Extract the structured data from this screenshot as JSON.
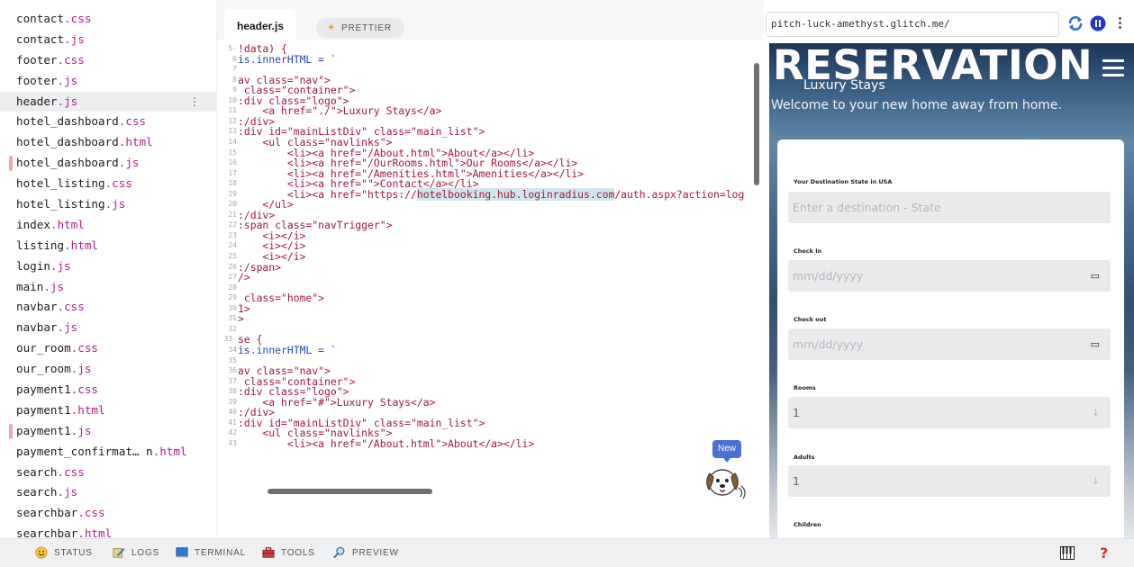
{
  "sidebar": {
    "files": [
      {
        "name": "contact",
        "ext": ".css",
        "marked": false,
        "active": false
      },
      {
        "name": "contact",
        "ext": ".js",
        "marked": false,
        "active": false
      },
      {
        "name": "footer",
        "ext": ".css",
        "marked": false,
        "active": false
      },
      {
        "name": "footer",
        "ext": ".js",
        "marked": false,
        "active": false
      },
      {
        "name": "header",
        "ext": ".js",
        "marked": false,
        "active": true,
        "menu": "⋮"
      },
      {
        "name": "hotel_dashboard",
        "ext": ".css",
        "marked": false,
        "active": false
      },
      {
        "name": "hotel_dashboard",
        "ext": ".html",
        "marked": false,
        "active": false
      },
      {
        "name": "hotel_dashboard",
        "ext": ".js",
        "marked": true,
        "active": false
      },
      {
        "name": "hotel_listing",
        "ext": ".css",
        "marked": false,
        "active": false
      },
      {
        "name": "hotel_listing",
        "ext": ".js",
        "marked": false,
        "active": false
      },
      {
        "name": "index",
        "ext": ".html",
        "marked": false,
        "active": false
      },
      {
        "name": "listing",
        "ext": ".html",
        "marked": false,
        "active": false
      },
      {
        "name": "login",
        "ext": ".js",
        "marked": false,
        "active": false
      },
      {
        "name": "main",
        "ext": ".js",
        "marked": false,
        "active": false
      },
      {
        "name": "navbar",
        "ext": ".css",
        "marked": false,
        "active": false
      },
      {
        "name": "navbar",
        "ext": ".js",
        "marked": false,
        "active": false
      },
      {
        "name": "our_room",
        "ext": ".css",
        "marked": false,
        "active": false
      },
      {
        "name": "our_room",
        "ext": ".js",
        "marked": false,
        "active": false
      },
      {
        "name": "payment1",
        "ext": ".css",
        "marked": false,
        "active": false
      },
      {
        "name": "payment1",
        "ext": ".html",
        "marked": false,
        "active": false
      },
      {
        "name": "payment1",
        "ext": ".js",
        "marked": true,
        "active": false
      },
      {
        "name": "payment_confirmat… n",
        "ext": ".html",
        "marked": false,
        "active": false
      },
      {
        "name": "search",
        "ext": ".css",
        "marked": false,
        "active": false
      },
      {
        "name": "search",
        "ext": ".js",
        "marked": false,
        "active": false
      },
      {
        "name": "searchbar",
        "ext": ".css",
        "marked": false,
        "active": false
      },
      {
        "name": "searchbar",
        "ext": ".html",
        "marked": false,
        "active": false
      }
    ]
  },
  "editor": {
    "tab_label": "header.js",
    "prettier_label": "PRETTIER",
    "new_badge": "New",
    "lines": [
      {
        "n": "5",
        "fold": true,
        "text": "!data) {",
        "blue": false
      },
      {
        "n": "6",
        "text": "is.innerHTML = `",
        "blue": true
      },
      {
        "n": "7",
        "text": ""
      },
      {
        "n": "8",
        "text": "av class=\"nav\">"
      },
      {
        "n": "9",
        "text": " class=\"container\">"
      },
      {
        "n": "10",
        "text": ":div class=\"logo\">"
      },
      {
        "n": "11",
        "text": "    <a href=\"./\">Luxury Stays</a>"
      },
      {
        "n": "12",
        "text": ":/div>"
      },
      {
        "n": "13",
        "text": ":div id=\"mainListDiv\" class=\"main_list\">"
      },
      {
        "n": "14",
        "text": "    <ul class=\"navlinks\">"
      },
      {
        "n": "15",
        "text": "        <li><a href=\"/About.html\">About</a></li>"
      },
      {
        "n": "16",
        "text": "        <li><a href=\"/OurRooms.html\">Our Rooms</a></li>"
      },
      {
        "n": "17",
        "text": "        <li><a href=\"/Amenities.html\">Amenities</a></li>"
      },
      {
        "n": "18",
        "text": "        <li><a href=\"\">Contact</a></li>"
      },
      {
        "n": "19",
        "text_pre": "        <li><a href=\"https://",
        "text_hl": "hotelbooking.hub.loginradius.com",
        "text_post": "/auth.aspx?action=log"
      },
      {
        "n": "20",
        "text": "    </ul>"
      },
      {
        "n": "21",
        "text": ":/div>"
      },
      {
        "n": "22",
        "text": ":span class=\"navTrigger\">"
      },
      {
        "n": "23",
        "text": "    <i></i>"
      },
      {
        "n": "24",
        "text": "    <i></i>"
      },
      {
        "n": "25",
        "text": "    <i></i>"
      },
      {
        "n": "26",
        "text": ":/span>"
      },
      {
        "n": "27",
        "text": "/>"
      },
      {
        "n": "28",
        "text": ""
      },
      {
        "n": "29",
        "text": " class=\"home\">"
      },
      {
        "n": "30",
        "text": "1>"
      },
      {
        "n": "31",
        "text": ">"
      },
      {
        "n": "32",
        "text": ""
      },
      {
        "n": "33",
        "fold": true,
        "text": "se {",
        "blue": false
      },
      {
        "n": "34",
        "text": "is.innerHTML = `",
        "blue": true
      },
      {
        "n": "35",
        "text": ""
      },
      {
        "n": "36",
        "text": "av class=\"nav\">"
      },
      {
        "n": "37",
        "text": " class=\"container\">"
      },
      {
        "n": "38",
        "text": ":div class=\"logo\">"
      },
      {
        "n": "39",
        "text": "    <a href=\"#\">Luxury Stays</a>"
      },
      {
        "n": "40",
        "text": ":/div>"
      },
      {
        "n": "41",
        "text": ":div id=\"mainListDiv\" class=\"main_list\">"
      },
      {
        "n": "42",
        "text": "    <ul class=\"navlinks\">"
      },
      {
        "n": "43",
        "text": "        <li><a href=\"/About.html\">About</a></li>"
      }
    ]
  },
  "preview": {
    "url": "pitch-luck-amethyst.glitch.me/",
    "colors": {
      "refresh": "#2e6de0",
      "pause_bg": "#2436c9"
    },
    "site": {
      "title": "RESERVATION",
      "brand": "Luxury Stays",
      "tagline": "Welcome to your new home away from home."
    },
    "form": {
      "destination_label": "Your Destination State in USA",
      "destination_placeholder": "Enter a destination - State",
      "checkin_label": "Check In",
      "checkin_placeholder": "mm/dd/yyyy",
      "checkout_label": "Check out",
      "checkout_placeholder": "mm/dd/yyyy",
      "rooms_label": "Rooms",
      "rooms_value": "1",
      "adults_label": "Adults",
      "adults_value": "1",
      "children_label": "Children"
    }
  },
  "bottombar": {
    "status": "STATUS",
    "logs": "LOGS",
    "terminal": "TERMINAL",
    "tools": "TOOLS",
    "preview": "PREVIEW",
    "help": "?"
  }
}
